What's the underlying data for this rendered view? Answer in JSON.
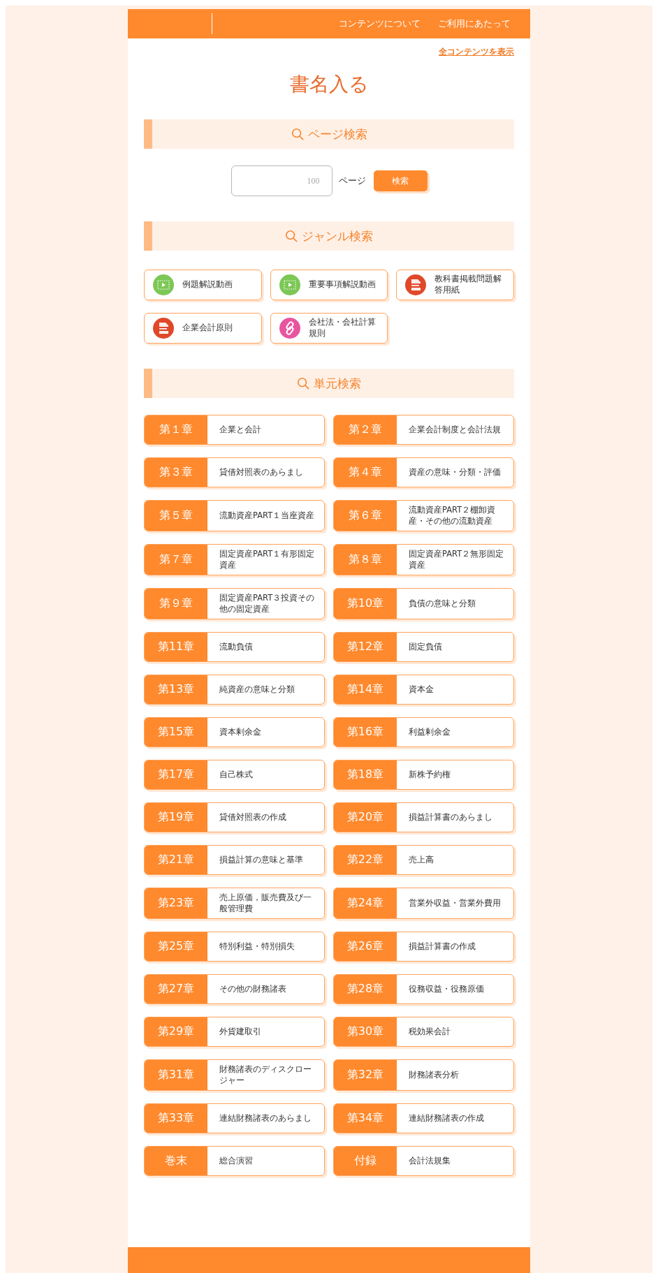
{
  "header": {
    "links": [
      "コンテンツについて",
      "ご利用にあたって"
    ]
  },
  "all_contents_link": "全コンテンツを表示",
  "title": "書名入る",
  "page_search": {
    "heading": "ページ検索",
    "placeholder": "100",
    "unit": "ページ",
    "button": "検索"
  },
  "genre_search": {
    "heading": "ジャンル検索",
    "items": [
      {
        "kind": "video",
        "label": "例題解説動画"
      },
      {
        "kind": "video",
        "label": "重要事項解説動画"
      },
      {
        "kind": "pdf",
        "label": "教科書掲載問題解答用紙"
      },
      {
        "kind": "pdf",
        "label": "企業会計原則"
      },
      {
        "kind": "link",
        "label": "会社法・会社計算規則"
      }
    ]
  },
  "unit_search": {
    "heading": "単元検索",
    "chapters": [
      {
        "label": "第１章",
        "title": "企業と会計"
      },
      {
        "label": "第２章",
        "title": "企業会計制度と会計法規"
      },
      {
        "label": "第３章",
        "title": "貸借対照表のあらまし"
      },
      {
        "label": "第４章",
        "title": "資産の意味・分類・評価"
      },
      {
        "label": "第５章",
        "title": "流動資産PART１当座資産"
      },
      {
        "label": "第６章",
        "title": "流動資産PART２棚卸資産・その他の流動資産"
      },
      {
        "label": "第７章",
        "title": "固定資産PART１有形固定資産"
      },
      {
        "label": "第８章",
        "title": "固定資産PART２無形固定資産"
      },
      {
        "label": "第９章",
        "title": "固定資産PART３投資その他の固定資産"
      },
      {
        "label": "第10章",
        "title": "負債の意味と分類"
      },
      {
        "label": "第11章",
        "title": "流動負債"
      },
      {
        "label": "第12章",
        "title": "固定負債"
      },
      {
        "label": "第13章",
        "title": "純資産の意味と分類"
      },
      {
        "label": "第14章",
        "title": "資本金"
      },
      {
        "label": "第15章",
        "title": "資本剰余金"
      },
      {
        "label": "第16章",
        "title": "利益剰余金"
      },
      {
        "label": "第17章",
        "title": "自己株式"
      },
      {
        "label": "第18章",
        "title": "新株予約権"
      },
      {
        "label": "第19章",
        "title": "貸借対照表の作成"
      },
      {
        "label": "第20章",
        "title": "損益計算書のあらまし"
      },
      {
        "label": "第21章",
        "title": "損益計算の意味と基準"
      },
      {
        "label": "第22章",
        "title": "売上高"
      },
      {
        "label": "第23章",
        "title": "売上原価，販売費及び一般管理費"
      },
      {
        "label": "第24章",
        "title": "営業外収益・営業外費用"
      },
      {
        "label": "第25章",
        "title": "特別利益・特別損失"
      },
      {
        "label": "第26章",
        "title": "損益計算書の作成"
      },
      {
        "label": "第27章",
        "title": "その他の財務諸表"
      },
      {
        "label": "第28章",
        "title": "役務収益・役務原価"
      },
      {
        "label": "第29章",
        "title": "外貨建取引"
      },
      {
        "label": "第30章",
        "title": "税効果会計"
      },
      {
        "label": "第31章",
        "title": "財務諸表のディスクロージャー"
      },
      {
        "label": "第32章",
        "title": "財務諸表分析"
      },
      {
        "label": "第33章",
        "title": "連結財務諸表のあらまし"
      },
      {
        "label": "第34章",
        "title": "連結財務諸表の作成"
      },
      {
        "label": "巻末",
        "title": "総合演習"
      },
      {
        "label": "付録",
        "title": "会計法規集"
      }
    ]
  }
}
